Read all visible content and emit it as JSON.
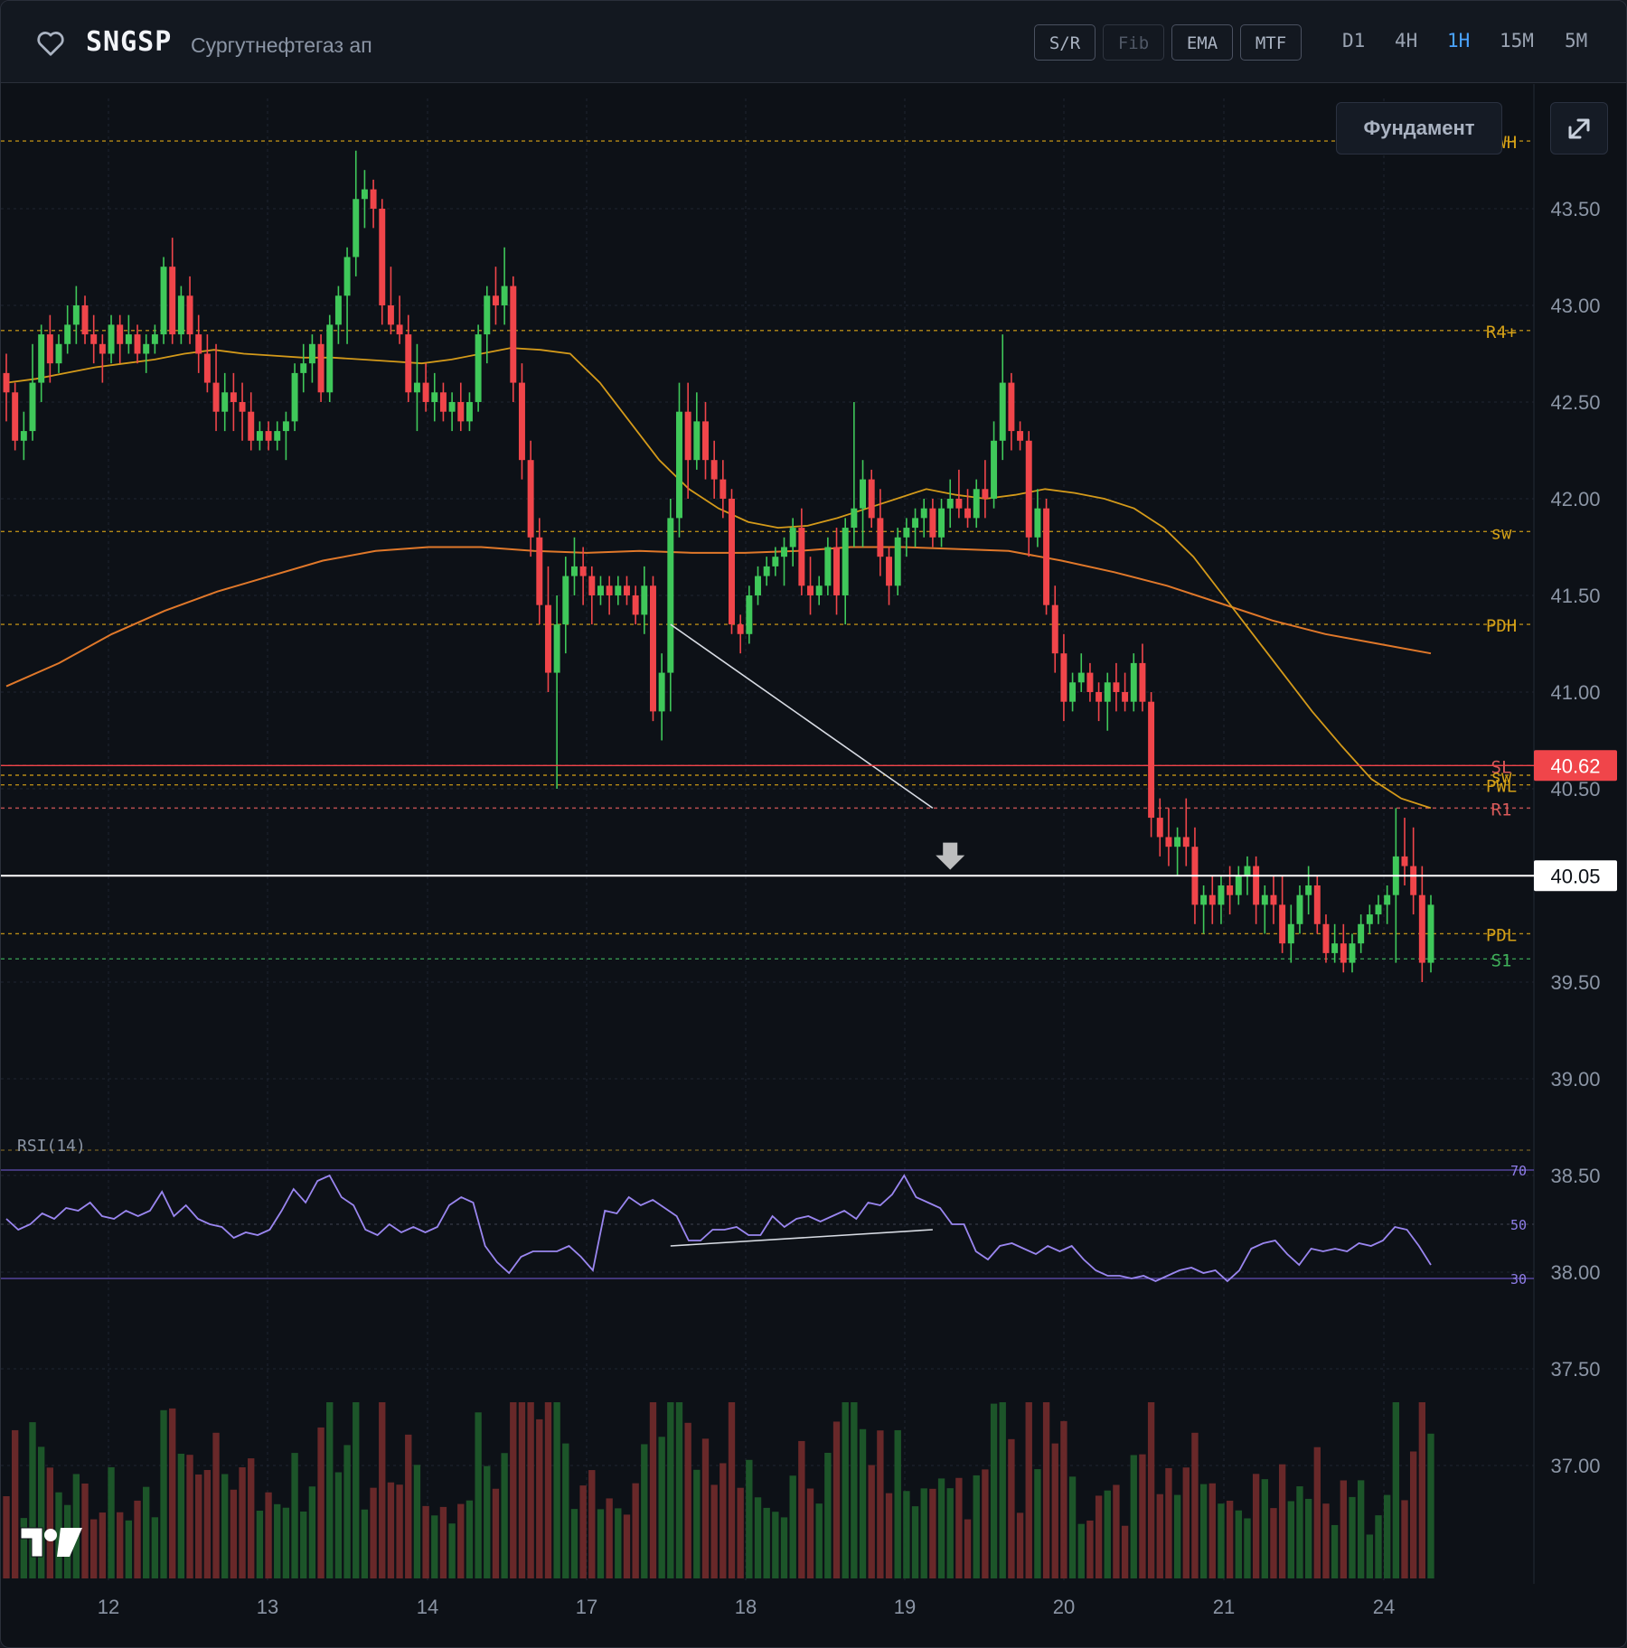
{
  "header": {
    "ticker": "SNGSP",
    "company": "Сургутнефтегаз ап",
    "tools": [
      "S/R",
      "Fib",
      "EMA",
      "MTF"
    ],
    "timeframes": [
      "D1",
      "4H",
      "1H",
      "15M",
      "5M"
    ],
    "active_timeframe": "1H"
  },
  "buttons": {
    "fundamental": "Фундамент"
  },
  "icons": {
    "favorite": "heart-outline-icon",
    "expand": "expand-arrows-icon",
    "logo": "tradingview-logo-icon"
  },
  "chart_data": {
    "type": "candlestick",
    "symbol": "SNGSP",
    "interval": "1H",
    "y_axis_labels": [
      "43.50",
      "43.00",
      "42.50",
      "42.00",
      "41.50",
      "41.00",
      "40.50",
      "39.50",
      "39.00",
      "38.50",
      "38.00",
      "37.50",
      "37.00"
    ],
    "x_axis_labels": [
      "12",
      "13",
      "14",
      "17",
      "18",
      "19",
      "20",
      "21",
      "24"
    ],
    "ylim": [
      36.6,
      44.0
    ],
    "last_price": 40.62,
    "cursor_price": 40.05,
    "levels": [
      {
        "label": "PWH",
        "value": 43.85,
        "color": "#d4a017"
      },
      {
        "label": "R4+",
        "value": 42.87,
        "color": "#d4a017"
      },
      {
        "label": "sw",
        "value": 41.83,
        "color": "#d4a017"
      },
      {
        "label": "PDH",
        "value": 41.35,
        "color": "#d4a017"
      },
      {
        "label": "SL",
        "value": 40.62,
        "color": "#d95a5a"
      },
      {
        "label": "sw",
        "value": 40.57,
        "color": "#d4a017"
      },
      {
        "label": "PWL",
        "value": 40.52,
        "color": "#d4a017"
      },
      {
        "label": "R1",
        "value": 40.4,
        "color": "#d95a5a"
      },
      {
        "label": "PDL",
        "value": 39.75,
        "color": "#d4a017"
      },
      {
        "label": "S1",
        "value": 39.62,
        "color": "#3fb05a"
      }
    ],
    "candles_ohlc": [
      [
        42.65,
        42.75,
        42.4,
        42.55
      ],
      [
        42.55,
        42.6,
        42.25,
        42.3
      ],
      [
        42.3,
        42.45,
        42.2,
        42.35
      ],
      [
        42.35,
        42.8,
        42.3,
        42.6
      ],
      [
        42.6,
        42.9,
        42.5,
        42.85
      ],
      [
        42.85,
        42.95,
        42.6,
        42.7
      ],
      [
        42.7,
        42.85,
        42.65,
        42.8
      ],
      [
        42.8,
        43.0,
        42.75,
        42.9
      ],
      [
        42.9,
        43.1,
        42.8,
        43.0
      ],
      [
        43.0,
        43.05,
        42.8,
        42.85
      ],
      [
        42.85,
        42.95,
        42.7,
        42.8
      ],
      [
        42.8,
        42.85,
        42.6,
        42.75
      ],
      [
        42.75,
        42.95,
        42.7,
        42.9
      ],
      [
        42.9,
        42.95,
        42.7,
        42.8
      ],
      [
        42.8,
        42.95,
        42.75,
        42.85
      ],
      [
        42.85,
        42.9,
        42.7,
        42.75
      ],
      [
        42.75,
        42.85,
        42.65,
        42.8
      ],
      [
        42.8,
        42.9,
        42.75,
        42.85
      ],
      [
        42.85,
        43.25,
        42.8,
        43.2
      ],
      [
        43.2,
        43.35,
        42.8,
        42.85
      ],
      [
        42.85,
        43.1,
        42.8,
        43.05
      ],
      [
        43.05,
        43.15,
        42.8,
        42.85
      ],
      [
        42.85,
        42.95,
        42.65,
        42.75
      ],
      [
        42.75,
        42.85,
        42.55,
        42.6
      ],
      [
        42.6,
        42.8,
        42.35,
        42.45
      ],
      [
        42.45,
        42.65,
        42.35,
        42.55
      ],
      [
        42.55,
        42.65,
        42.35,
        42.5
      ],
      [
        42.5,
        42.6,
        42.3,
        42.45
      ],
      [
        42.45,
        42.55,
        42.25,
        42.3
      ],
      [
        42.3,
        42.4,
        42.25,
        42.35
      ],
      [
        42.35,
        42.4,
        42.25,
        42.3
      ],
      [
        42.3,
        42.4,
        42.25,
        42.35
      ],
      [
        42.35,
        42.45,
        42.2,
        42.4
      ],
      [
        42.4,
        42.7,
        42.35,
        42.65
      ],
      [
        42.65,
        42.8,
        42.55,
        42.7
      ],
      [
        42.7,
        42.85,
        42.6,
        42.8
      ],
      [
        42.8,
        42.85,
        42.5,
        42.55
      ],
      [
        42.55,
        42.95,
        42.5,
        42.9
      ],
      [
        42.9,
        43.1,
        42.8,
        43.05
      ],
      [
        43.05,
        43.3,
        42.8,
        43.25
      ],
      [
        43.25,
        43.8,
        43.15,
        43.55
      ],
      [
        43.55,
        43.7,
        43.4,
        43.6
      ],
      [
        43.6,
        43.65,
        43.4,
        43.5
      ],
      [
        43.5,
        43.55,
        42.9,
        43.0
      ],
      [
        43.0,
        43.2,
        42.85,
        42.9
      ],
      [
        42.9,
        43.05,
        42.8,
        42.85
      ],
      [
        42.85,
        42.95,
        42.5,
        42.55
      ],
      [
        42.55,
        42.8,
        42.35,
        42.6
      ],
      [
        42.6,
        42.7,
        42.45,
        42.5
      ],
      [
        42.5,
        42.65,
        42.4,
        42.55
      ],
      [
        42.55,
        42.6,
        42.4,
        42.45
      ],
      [
        42.45,
        42.55,
        42.35,
        42.5
      ],
      [
        42.5,
        42.6,
        42.35,
        42.4
      ],
      [
        42.4,
        42.55,
        42.35,
        42.5
      ],
      [
        42.5,
        42.9,
        42.45,
        42.85
      ],
      [
        42.85,
        43.1,
        42.7,
        43.05
      ],
      [
        43.05,
        43.2,
        42.9,
        43.0
      ],
      [
        43.0,
        43.3,
        42.9,
        43.1
      ],
      [
        43.1,
        43.15,
        42.5,
        42.6
      ],
      [
        42.6,
        42.7,
        42.1,
        42.2
      ],
      [
        42.2,
        42.3,
        41.7,
        41.8
      ],
      [
        41.8,
        41.9,
        41.35,
        41.45
      ],
      [
        41.45,
        41.65,
        41.0,
        41.1
      ],
      [
        41.1,
        41.5,
        40.5,
        41.35
      ],
      [
        41.35,
        41.7,
        41.2,
        41.6
      ],
      [
        41.6,
        41.8,
        41.5,
        41.65
      ],
      [
        41.65,
        41.75,
        41.45,
        41.6
      ],
      [
        41.6,
        41.65,
        41.35,
        41.5
      ],
      [
        41.5,
        41.6,
        41.45,
        41.55
      ],
      [
        41.55,
        41.6,
        41.4,
        41.5
      ],
      [
        41.5,
        41.6,
        41.45,
        41.55
      ],
      [
        41.55,
        41.6,
        41.45,
        41.5
      ],
      [
        41.5,
        41.55,
        41.35,
        41.4
      ],
      [
        41.4,
        41.65,
        41.3,
        41.55
      ],
      [
        41.55,
        41.6,
        40.85,
        40.9
      ],
      [
        40.9,
        41.2,
        40.75,
        41.1
      ],
      [
        41.1,
        42.0,
        40.9,
        41.9
      ],
      [
        41.9,
        42.6,
        41.8,
        42.45
      ],
      [
        42.45,
        42.6,
        42.0,
        42.2
      ],
      [
        42.2,
        42.55,
        42.15,
        42.4
      ],
      [
        42.4,
        42.5,
        42.1,
        42.2
      ],
      [
        42.2,
        42.3,
        42.0,
        42.1
      ],
      [
        42.1,
        42.2,
        41.9,
        42.0
      ],
      [
        42.0,
        42.05,
        41.3,
        41.35
      ],
      [
        41.35,
        41.4,
        41.2,
        41.3
      ],
      [
        41.3,
        41.55,
        41.25,
        41.5
      ],
      [
        41.5,
        41.65,
        41.45,
        41.6
      ],
      [
        41.6,
        41.7,
        41.55,
        41.65
      ],
      [
        41.65,
        41.75,
        41.6,
        41.7
      ],
      [
        41.7,
        41.8,
        41.55,
        41.75
      ],
      [
        41.75,
        41.9,
        41.65,
        41.85
      ],
      [
        41.85,
        41.95,
        41.5,
        41.55
      ],
      [
        41.55,
        41.7,
        41.4,
        41.5
      ],
      [
        41.5,
        41.6,
        41.45,
        41.55
      ],
      [
        41.55,
        41.8,
        41.5,
        41.75
      ],
      [
        41.75,
        41.85,
        41.4,
        41.5
      ],
      [
        41.5,
        41.9,
        41.35,
        41.85
      ],
      [
        41.85,
        42.5,
        41.75,
        41.95
      ],
      [
        41.95,
        42.2,
        41.75,
        42.1
      ],
      [
        42.1,
        42.15,
        41.85,
        41.9
      ],
      [
        41.9,
        42.05,
        41.6,
        41.7
      ],
      [
        41.7,
        41.75,
        41.45,
        41.55
      ],
      [
        41.55,
        41.85,
        41.5,
        41.8
      ],
      [
        41.8,
        41.9,
        41.7,
        41.85
      ],
      [
        41.85,
        41.95,
        41.75,
        41.9
      ],
      [
        41.9,
        42.0,
        41.8,
        41.95
      ],
      [
        41.95,
        42.0,
        41.75,
        41.8
      ],
      [
        41.8,
        42.0,
        41.75,
        41.95
      ],
      [
        41.95,
        42.1,
        41.85,
        42.0
      ],
      [
        42.0,
        42.15,
        41.9,
        41.95
      ],
      [
        41.95,
        42.05,
        41.85,
        41.9
      ],
      [
        41.9,
        42.1,
        41.85,
        42.05
      ],
      [
        42.05,
        42.2,
        41.9,
        42.0
      ],
      [
        42.0,
        42.4,
        41.95,
        42.3
      ],
      [
        42.3,
        42.85,
        42.2,
        42.6
      ],
      [
        42.6,
        42.65,
        42.25,
        42.35
      ],
      [
        42.35,
        42.4,
        42.25,
        42.3
      ],
      [
        42.3,
        42.35,
        41.7,
        41.8
      ],
      [
        41.8,
        42.05,
        41.75,
        41.95
      ],
      [
        41.95,
        42.0,
        41.4,
        41.45
      ],
      [
        41.45,
        41.55,
        41.1,
        41.2
      ],
      [
        41.2,
        41.3,
        40.85,
        40.95
      ],
      [
        40.95,
        41.1,
        40.9,
        41.05
      ],
      [
        41.05,
        41.2,
        41.0,
        41.1
      ],
      [
        41.1,
        41.15,
        40.95,
        41.0
      ],
      [
        41.0,
        41.05,
        40.85,
        40.95
      ],
      [
        40.95,
        41.1,
        40.8,
        41.05
      ],
      [
        41.05,
        41.15,
        40.9,
        41.0
      ],
      [
        41.0,
        41.1,
        40.9,
        40.95
      ],
      [
        40.95,
        41.2,
        40.9,
        41.15
      ],
      [
        41.15,
        41.25,
        40.9,
        40.95
      ],
      [
        40.95,
        41.0,
        40.25,
        40.35
      ],
      [
        40.35,
        40.45,
        40.15,
        40.25
      ],
      [
        40.25,
        40.4,
        40.1,
        40.2
      ],
      [
        40.2,
        40.3,
        40.05,
        40.25
      ],
      [
        40.25,
        40.45,
        40.1,
        40.2
      ],
      [
        40.2,
        40.3,
        39.8,
        39.9
      ],
      [
        39.9,
        40.0,
        39.75,
        39.95
      ],
      [
        39.95,
        40.05,
        39.8,
        39.9
      ],
      [
        39.9,
        40.05,
        39.8,
        40.0
      ],
      [
        40.0,
        40.1,
        39.85,
        39.95
      ],
      [
        39.95,
        40.1,
        39.9,
        40.05
      ],
      [
        40.05,
        40.15,
        39.95,
        40.1
      ],
      [
        40.1,
        40.15,
        39.8,
        39.9
      ],
      [
        39.9,
        40.0,
        39.75,
        39.95
      ],
      [
        39.95,
        40.05,
        39.8,
        39.9
      ],
      [
        39.9,
        40.05,
        39.65,
        39.7
      ],
      [
        39.7,
        39.9,
        39.6,
        39.8
      ],
      [
        39.8,
        40.0,
        39.75,
        39.95
      ],
      [
        39.95,
        40.1,
        39.85,
        40.0
      ],
      [
        40.0,
        40.05,
        39.75,
        39.8
      ],
      [
        39.8,
        39.85,
        39.6,
        39.65
      ],
      [
        39.65,
        39.8,
        39.6,
        39.7
      ],
      [
        39.7,
        39.8,
        39.55,
        39.6
      ],
      [
        39.6,
        39.75,
        39.55,
        39.7
      ],
      [
        39.7,
        39.85,
        39.65,
        39.8
      ],
      [
        39.8,
        39.9,
        39.75,
        39.85
      ],
      [
        39.85,
        39.95,
        39.8,
        39.9
      ],
      [
        39.9,
        40.0,
        39.8,
        39.95
      ],
      [
        39.95,
        40.4,
        39.6,
        40.15
      ],
      [
        40.15,
        40.35,
        40.0,
        40.1
      ],
      [
        40.1,
        40.3,
        39.85,
        39.95
      ],
      [
        39.95,
        40.1,
        39.5,
        39.6
      ],
      [
        39.6,
        39.95,
        39.55,
        39.9
      ]
    ],
    "ema_fast": [
      42.6,
      42.62,
      42.65,
      42.68,
      42.7,
      42.72,
      42.75,
      42.77,
      42.75,
      42.74,
      42.73,
      42.73,
      42.72,
      42.71,
      42.7,
      42.72,
      42.75,
      42.78,
      42.77,
      42.75,
      42.6,
      42.4,
      42.2,
      42.05,
      41.95,
      41.88,
      41.85,
      41.86,
      41.9,
      41.95,
      42.0,
      42.05,
      42.02,
      42.0,
      42.02,
      42.05,
      42.03,
      42.0,
      41.95,
      41.85,
      41.7,
      41.5,
      41.3,
      41.1,
      40.9,
      40.72,
      40.55,
      40.45,
      40.4
    ],
    "ema_slow": [
      41.03,
      41.15,
      41.3,
      41.42,
      41.52,
      41.6,
      41.68,
      41.73,
      41.75,
      41.75,
      41.73,
      41.72,
      41.73,
      41.72,
      41.72,
      41.73,
      41.75,
      41.75,
      41.74,
      41.73,
      41.68,
      41.62,
      41.55,
      41.46,
      41.37,
      41.3,
      41.25,
      41.2
    ],
    "rsi": {
      "label": "RSI(14)",
      "overbought": 70,
      "mid": 50,
      "oversold": 30,
      "values": [
        52,
        48,
        50,
        54,
        52,
        56,
        55,
        58,
        53,
        52,
        55,
        53,
        55,
        62,
        53,
        57,
        52,
        50,
        49,
        45,
        47,
        46,
        48,
        55,
        63,
        58,
        66,
        68,
        60,
        57,
        48,
        46,
        50,
        47,
        49,
        47,
        49,
        57,
        60,
        58,
        42,
        36,
        32,
        38,
        40,
        40,
        40,
        42,
        38,
        33,
        55,
        54,
        60,
        57,
        59,
        56,
        53,
        44,
        44,
        48,
        48,
        49,
        46,
        46,
        53,
        49,
        52,
        53,
        51,
        53,
        55,
        52,
        58,
        57,
        61,
        68,
        60,
        58,
        56,
        50,
        50,
        40,
        37,
        42,
        43,
        41,
        39,
        42,
        40,
        42,
        37,
        33,
        31,
        31,
        30,
        31,
        29,
        31,
        33,
        34,
        32,
        33,
        29,
        33,
        41,
        43,
        44,
        39,
        35,
        41,
        40,
        41,
        40,
        43,
        42,
        44,
        49,
        48,
        42,
        35
      ],
      "trendline": [
        [
          76,
          42
        ],
        [
          106,
          48
        ]
      ]
    },
    "volume": [
      {
        "bull": true,
        "v": 0.45
      }
    ],
    "trendline": {
      "from": [
        76,
        41.35
      ],
      "to": [
        106,
        40.4
      ]
    },
    "signal_marker": {
      "type": "sell-arrow",
      "index": 108,
      "value": 40.1
    }
  }
}
